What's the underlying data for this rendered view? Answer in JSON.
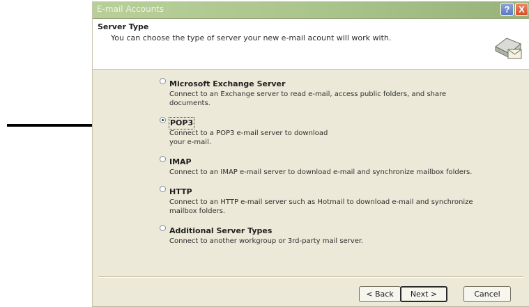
{
  "dialog": {
    "title": "E-mail Accounts",
    "help_glyph": "?",
    "close_glyph": "X"
  },
  "header": {
    "title": "Server Type",
    "subtitle": "You can choose the type of server your new e-mail acount will work with."
  },
  "options": [
    {
      "label": "Microsoft Exchange Server",
      "description": "Connect to an Exchange server to read e-mail, access public folders, and share documents.",
      "selected": false
    },
    {
      "label": "POP3",
      "description_lines": [
        "Connect to a POP3 e-mail server to download",
        "your e-mail."
      ],
      "selected": true
    },
    {
      "label": "IMAP",
      "description": "Connect to an IMAP e-mail server to download e-mail and synchronize mailbox folders.",
      "selected": false
    },
    {
      "label": "HTTP",
      "description": "Connect to an HTTP e-mail server such as Hotmail to download e-mail and synchronize mailbox folders.",
      "selected": false
    },
    {
      "label": "Additional Server Types",
      "description": "Connect to another workgroup or 3rd-party mail server.",
      "selected": false
    }
  ],
  "buttons": {
    "back": "< Back",
    "next": "Next >",
    "cancel": "Cancel"
  },
  "colors": {
    "titlebar": "#a9c48a",
    "dialog_background": "#ece9d8",
    "arrow": "#000000"
  },
  "icons": {
    "header": "server-mail-icon",
    "annotation": "arrow-right-icon"
  }
}
